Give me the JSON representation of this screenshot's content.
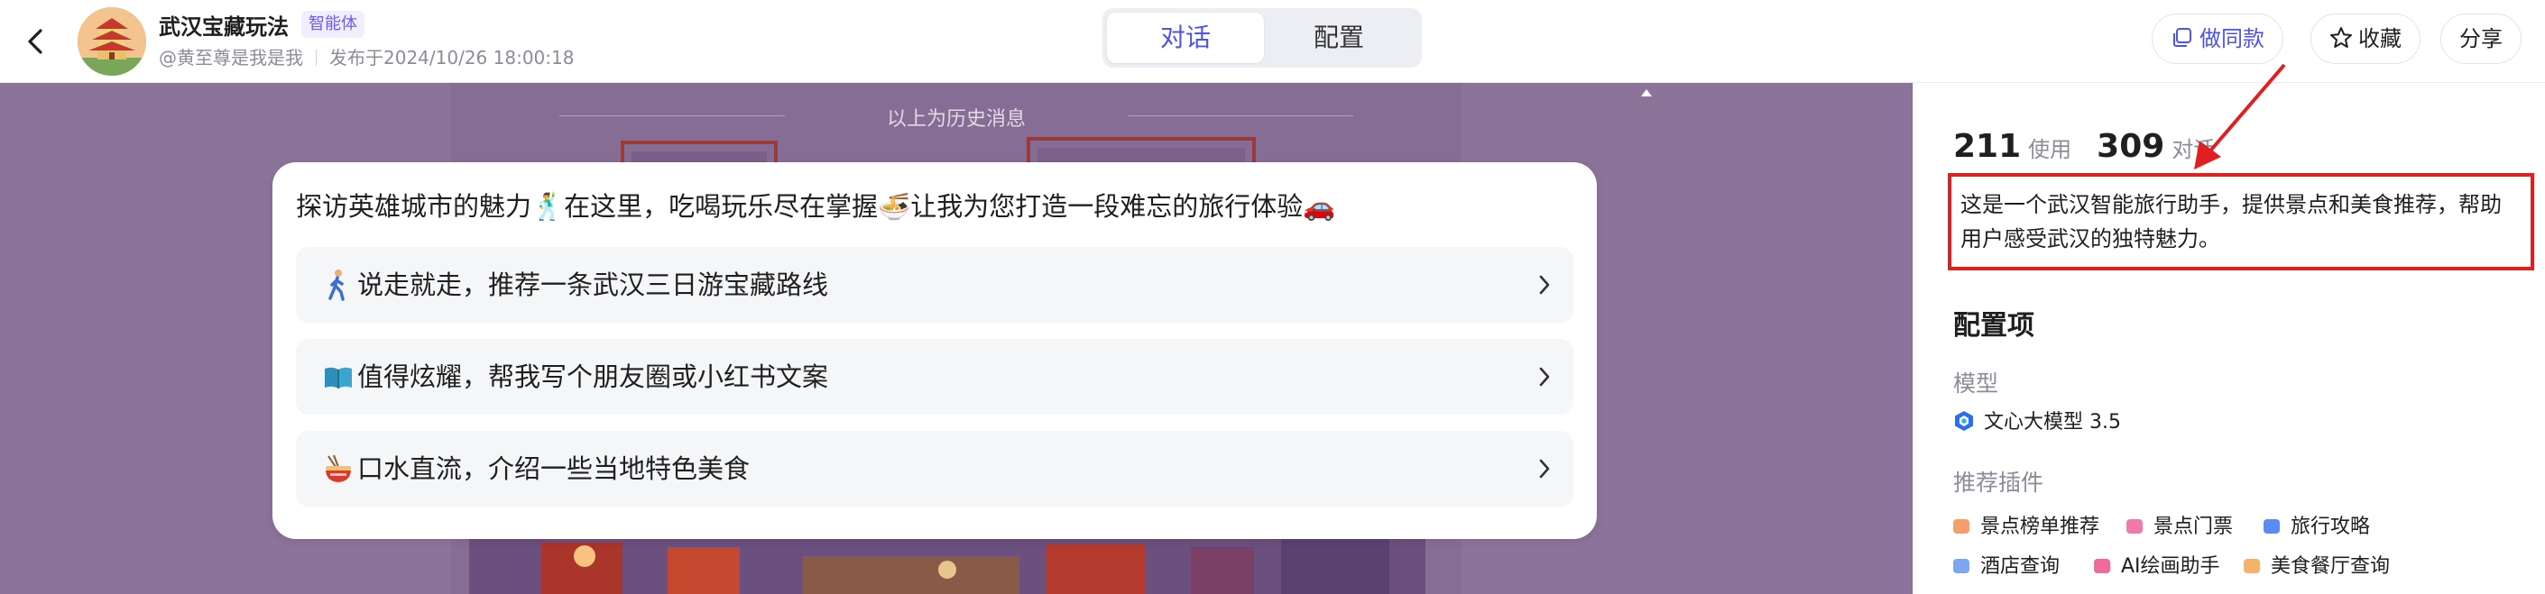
{
  "header": {
    "app_title": "武汉宝藏玩法",
    "agent_badge": "智能体",
    "author": "@黄至尊是我是我",
    "published": "发布于2024/10/26 18:00:18",
    "tabs": [
      {
        "label": "对话",
        "active": true
      },
      {
        "label": "配置",
        "active": false
      }
    ],
    "buttons": {
      "make_same": "做同款",
      "favorite": "收藏",
      "share": "分享"
    }
  },
  "chat": {
    "history_label": "以上为历史消息",
    "greeting": "探访英雄城市的魅力🕺在这里，吃喝玩乐尽在掌握🍜让我为您打造一段难忘的旅行体验🚗",
    "suggestions": [
      {
        "text": "说走就走，推荐一条武汉三日游宝藏路线",
        "icon": "walking-person-icon"
      },
      {
        "text": "值得炫耀，帮我写个朋友圈或小红书文案",
        "icon": "open-book-icon"
      },
      {
        "text": "口水直流，介绍一些当地特色美食",
        "icon": "noodle-bowl-icon"
      }
    ]
  },
  "sidebar": {
    "uses_count": "211",
    "uses_label": "使用",
    "dialogs_count": "309",
    "dialogs_label": "对话",
    "description": "这是一个武汉智能旅行助手，提供景点和美食推荐，帮助用户感受武汉的独特魅力。",
    "config_title": "配置项",
    "model_label": "模型",
    "model_name": "文心大模型 3.5",
    "plugins_label": "推荐插件",
    "plugins": [
      {
        "name": "景点榜单推荐",
        "color": "#f5a06a"
      },
      {
        "name": "景点门票",
        "color": "#f07aa8"
      },
      {
        "name": "旅行攻略",
        "color": "#5b8cf2"
      },
      {
        "name": "酒店查询",
        "color": "#7ea6f0"
      },
      {
        "name": "AI绘画助手",
        "color": "#f06a9a"
      },
      {
        "name": "美食餐厅查询",
        "color": "#f3b36a"
      }
    ]
  },
  "colors": {
    "accent": "#4d53e8",
    "highlight_box": "#e02020",
    "chat_background": "#8a7298"
  }
}
